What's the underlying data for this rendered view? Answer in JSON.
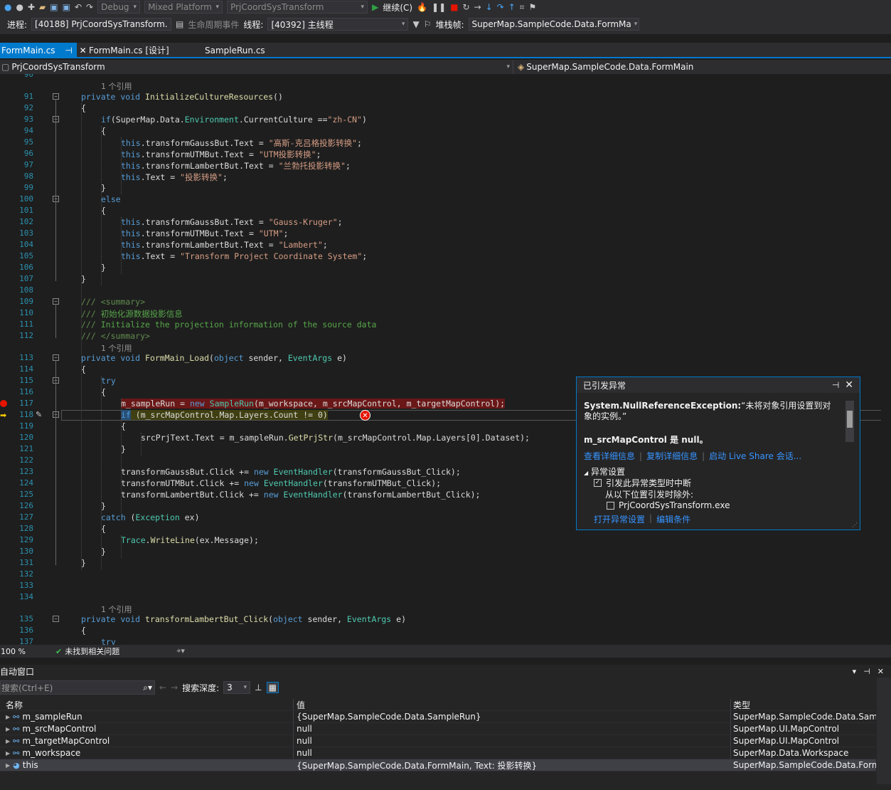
{
  "toolbar": {
    "config": "Debug",
    "platform": "Mixed Platform",
    "project": "PrjCoordSysTransform",
    "continue_label": "继续(C)",
    "process_label": "进程:",
    "process_value": "[40188] PrjCoordSysTransform.",
    "lifecycle_label": "生命周期事件",
    "thread_label": "线程:",
    "thread_value": "[40392] 主线程",
    "stackframe_label": "堆栈帧:",
    "stackframe_value": "SuperMap.SampleCode.Data.FormMa"
  },
  "tabs": [
    {
      "label": "FormMain.cs"
    },
    {
      "label": "FormMain.cs [设计]"
    },
    {
      "label": "SampleRun.cs"
    }
  ],
  "navbar": {
    "project": "PrjCoordSysTransform",
    "class": "SuperMap.SampleCode.Data.FormMain"
  },
  "code": {
    "top_partial_line": "90",
    "lines": [
      {
        "ref": "1 个引用"
      },
      {
        "n": "91"
      },
      {
        "n": "92"
      },
      {
        "n": "93"
      },
      {
        "n": "94"
      },
      {
        "n": "95"
      },
      {
        "n": "96"
      },
      {
        "n": "97"
      },
      {
        "n": "98"
      },
      {
        "n": "99"
      },
      {
        "n": "100"
      },
      {
        "n": "101"
      },
      {
        "n": "102"
      },
      {
        "n": "103"
      },
      {
        "n": "104"
      },
      {
        "n": "105"
      },
      {
        "n": "106"
      },
      {
        "n": "107"
      },
      {
        "n": "108"
      },
      {
        "n": "109"
      },
      {
        "n": "110"
      },
      {
        "n": "111"
      },
      {
        "n": "112"
      },
      {
        "n": "113"
      },
      {
        "n": "114"
      },
      {
        "n": "115"
      },
      {
        "n": "116"
      },
      {
        "n": "117"
      },
      {
        "n": "118"
      },
      {
        "n": "119"
      },
      {
        "n": "120"
      },
      {
        "n": "121"
      },
      {
        "n": "122"
      },
      {
        "n": "123"
      },
      {
        "n": "124"
      },
      {
        "n": "125"
      },
      {
        "n": "126"
      },
      {
        "n": "127"
      },
      {
        "n": "128"
      },
      {
        "n": "129"
      },
      {
        "n": "130"
      },
      {
        "n": "131"
      },
      {
        "n": "132"
      },
      {
        "n": "133"
      },
      {
        "n": "134"
      },
      {
        "n": "135"
      },
      {
        "n": "136"
      },
      {
        "n": "137"
      }
    ],
    "ref_label": "1 个引用"
  },
  "exception": {
    "title": "已引发异常",
    "type": "System.NullReferenceException:",
    "message": "“未将对象引用设置到对象的实例。”",
    "detail": "m_srcMapControl 是 null。",
    "link_details": "查看详细信息",
    "link_copy": "复制详细信息",
    "link_liveshare": "启动 Live Share 会话...",
    "settings_header": "异常设置",
    "chk_break": "引发此异常类型时中断",
    "except_label": "从以下位置引发时除外:",
    "chk_exe": "PrjCoordSysTransform.exe",
    "link_open": "打开异常设置",
    "link_edit": "编辑条件"
  },
  "status": {
    "zoom": "100 %",
    "issues": "未找到相关问题"
  },
  "autos": {
    "title": "自动窗口",
    "search_placeholder": "搜索(Ctrl+E)",
    "depth_label": "搜索深度:",
    "depth_value": "3",
    "col_name": "名称",
    "col_value": "值",
    "col_type": "类型",
    "rows": [
      {
        "name": "m_sampleRun",
        "value": "{SuperMap.SampleCode.Data.SampleRun}",
        "type": "SuperMap.SampleCode.Data.Sampl..."
      },
      {
        "name": "m_srcMapControl",
        "value": "null",
        "type": "SuperMap.UI.MapControl"
      },
      {
        "name": "m_targetMapControl",
        "value": "null",
        "type": "SuperMap.UI.MapControl"
      },
      {
        "name": "m_workspace",
        "value": "null",
        "type": "SuperMap.Data.Workspace"
      },
      {
        "name": "this",
        "value": "{SuperMap.SampleCode.Data.FormMain, Text: 投影转换}",
        "type": "SuperMap.SampleCode.Data.Form..."
      }
    ]
  },
  "colors": {
    "accent": "#007acc",
    "keyword": "#569cd6",
    "type": "#4ec9b0",
    "string": "#d69d85",
    "comment": "#57a64a",
    "breakpoint": "#e51400"
  }
}
